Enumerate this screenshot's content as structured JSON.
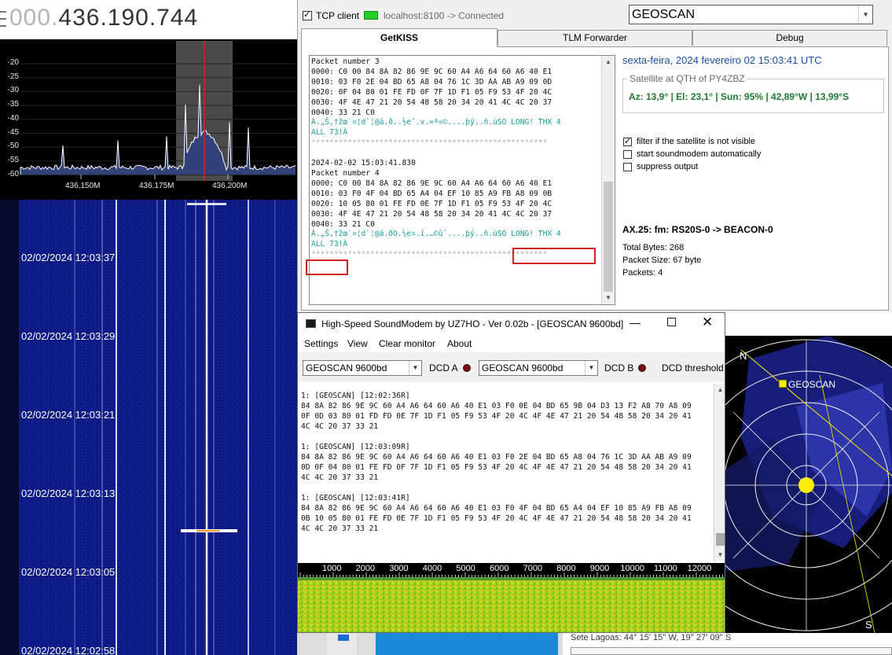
{
  "sdr": {
    "freq_dim": "000.",
    "freq_bright": "436.190.744",
    "spectrum_db_ticks": [
      "-20",
      "-25",
      "-30",
      "-35",
      "-40",
      "-45",
      "-50",
      "-55",
      "-60"
    ],
    "spectrum_freq_ticks": [
      "436,150M",
      "436,175M",
      "436,200M"
    ],
    "waterfall_timestamps": [
      "02/02/2024 12:03:37",
      "02/02/2024 12:03:29",
      "02/02/2024 12:03:21",
      "02/02/2024 12:03:13",
      "02/02/2024 12:03:05",
      "02/02/2024 12:02:58"
    ]
  },
  "kiss": {
    "tcp_client_label": "TCP client",
    "tcp_client_checked": true,
    "connection_status": "localhost:8100 -> Connected",
    "satellite_select": "GEOSCAN",
    "tabs": [
      "GetKISS",
      "TLM Forwarder",
      "Debug"
    ],
    "active_tab": "GetKISS",
    "log_lines_top": [
      "Packet number 3",
      "0000: C0 00 84 8A 82 86 9E 9C 60 A4 A6 64 60 A6 40 E1",
      "0010: 03 F0 2E 04 BD 65 A8 04 76 1C 3D AA AB A9 09 0D",
      "0020: 0F 04 80 01 FE FD 0F 7F 1D F1 05 F9 53 4F 20 4C",
      "0030: 4F 4E 47 21 20 54 48 58 20 34 20 41 4C 4C 20 37",
      "0040: 33 21 C0"
    ],
    "log_ascii_1a": "À.„Š,†žœ`¤¦d`¦@á.ð..½eˆ.v.=ª«©....þý..ñ.ùSO LONG! THX 4",
    "log_ascii_1b": "ALL 73!À",
    "log_separator": "****************************************************",
    "log_timestamp": "2024-02-02 15:03:41.830",
    "log_lines_bottom": [
      "Packet number 4",
      "0000: C0 00 84 8A 82 86 9E 9C 60 A4 A6 64 60 A6 40 E1",
      "0010: 03 F0 4F 04 BD 65 A4 04 EF 10 85 A9 FB A8 09 0B",
      "0020: 10 05 80 01 FE FD 0E 7F 1D F1 05 F9 53 4F 20 4C",
      "0030: 4F 4E 47 21 20 54 48 58 20 34 20 41 4C 4C 20 37",
      "0040: 33 21 C0"
    ],
    "log_ascii_2a": "À.„Š,†žœ`¤¦d`¦@á.ðO.½e¤.ï.…©û¨....þý..ñ.ùSO LONG! THX 4",
    "log_ascii_2b": "ALL 73!À",
    "datetime": "sexta-feira, 2024 fevereiro 02  15:03:41 UTC",
    "qth_group_label": "Satellite at QTH of PY4ZBZ",
    "qth_info": "Az: 13,9° | El: 23,1° | Sun: 95% | 42,89°W | 13,99°S",
    "options": [
      {
        "label": "filter if the satellite is not visible",
        "checked": true
      },
      {
        "label": "start soundmodem automatically",
        "checked": false
      },
      {
        "label": "suppress output",
        "checked": false
      }
    ],
    "ax25_line": "AX.25: fm: RS20S-0 -> BEACON-0",
    "total_bytes": "Total Bytes: 268",
    "packet_size": "Packet Size: 67 byte",
    "packets": "Packets: 4"
  },
  "modem": {
    "title": "High-Speed SoundModem by UZ7HO - Ver 0.02b - [GEOSCAN 9600bd]",
    "menu": [
      "Settings",
      "View",
      "Clear monitor",
      "About"
    ],
    "modem_a": "GEOSCAN 9600bd",
    "dcd_a": "DCD A",
    "modem_b": "GEOSCAN 9600bd",
    "dcd_b": "DCD B",
    "dcd_threshold": "DCD threshold",
    "log_lines": [
      "1: [GEOSCAN] [12:02:36R]",
      "84 8A 82 86 9E 9C 60 A4 A6 64 60 A6 40 E1 03 F0 0E 04 BD 65 9B 04 D3 13 F2 A8 70 A8 09",
      "0F 0D 03 80 01 FD FD 0E 7F 1D F1 05 F9 53 4F 20 4C 4F 4E 47 21 20 54 48 58 20 34 20 41",
      "4C 4C 20 37 33 21",
      "",
      "1: [GEOSCAN] [12:03:09R]",
      "84 8A 82 86 9E 9C 60 A4 A6 64 60 A6 40 E1 03 F0 2E 04 BD 65 A8 04 76 1C 3D AA AB A9 09",
      "0D 0F 04 80 01 FE FD 0F 7F 1D F1 05 F9 53 4F 20 4C 4F 4E 47 21 20 54 48 58 20 34 20 41",
      "4C 4C 20 37 33 21",
      "",
      "1: [GEOSCAN] [12:03:41R]",
      "84 8A 82 86 9E 9C 60 A4 A6 64 60 A6 40 E1 03 F0 4F 04 BD 65 A4 04 EF 10 85 A9 FB A8 09",
      "0B 10 05 80 01 FE FD 0E 7F 1D F1 05 F9 53 4F 20 4C 4F 4E 47 21 20 54 48 58 20 34 20 41",
      "4C 4C 20 37 33 21"
    ],
    "ruler_ticks": [
      "1000",
      "2000",
      "3000",
      "4000",
      "5000",
      "6000",
      "7000",
      "8000",
      "9000",
      "10000",
      "11000",
      "12000"
    ]
  },
  "polar": {
    "north": "N",
    "south": "S",
    "satellite_label": "GEOSCAN",
    "location": "Sete Lagoas: 44° 15' 15'' W, 19° 27' 09'' S"
  },
  "colors": {
    "waterfall_bg": "#0a1470",
    "spectrum_fill": "#3a4a80",
    "red_marker": "#d42020",
    "qth_green": "#207a30",
    "datetime_blue": "#1a4fa0",
    "sun_yellow": "#ffee00"
  }
}
